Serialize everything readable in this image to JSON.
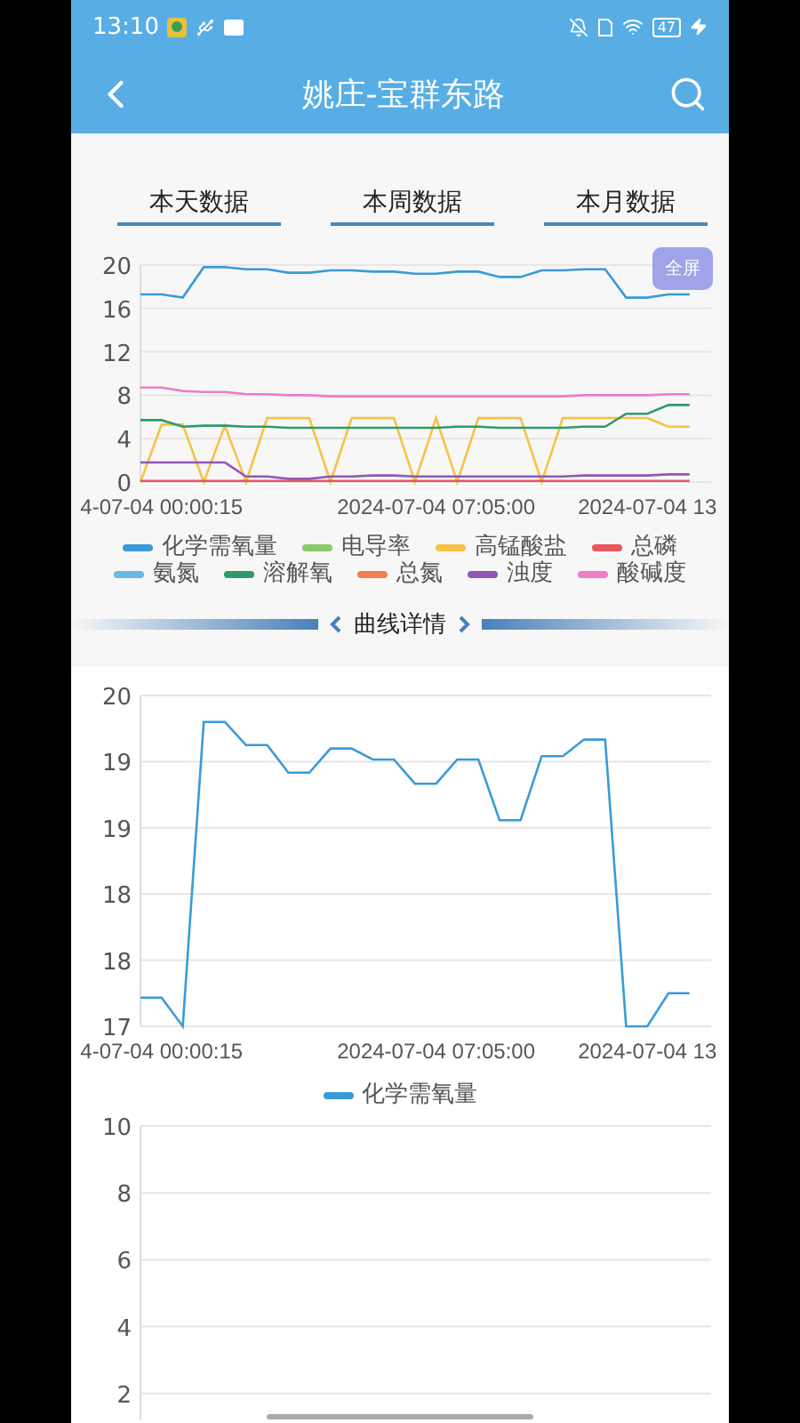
{
  "status_bar": {
    "time": "13:10",
    "battery": "47"
  },
  "header": {
    "title": "姚庄-宝群东路"
  },
  "tabs": [
    {
      "label": "本天数据"
    },
    {
      "label": "本周数据"
    },
    {
      "label": "本月数据"
    }
  ],
  "overview": {
    "fullscreen_button": "全屏",
    "chart_data": {
      "type": "line",
      "grid": true,
      "categories": [
        null,
        "4-07-04 00:00:15",
        null,
        null,
        null,
        null,
        null,
        null,
        null,
        null,
        null,
        null,
        null,
        null,
        "2024-07-04 07:05:00",
        null,
        null,
        null,
        null,
        null,
        null,
        null,
        null,
        null,
        "2024-07-04 13",
        null,
        null
      ],
      "ylim": [
        0,
        20
      ],
      "yticks": [
        0,
        4,
        8,
        12,
        16,
        20
      ],
      "series": [
        {
          "name": "化学需氧量",
          "color": "#3a9ad9",
          "values": [
            17.3,
            17.3,
            17.0,
            19.8,
            19.8,
            19.6,
            19.6,
            19.3,
            19.3,
            19.5,
            19.5,
            19.4,
            19.4,
            19.2,
            19.2,
            19.4,
            19.4,
            18.9,
            18.9,
            19.5,
            19.5,
            19.6,
            19.6,
            17.0,
            17.0,
            17.3,
            17.3
          ]
        },
        {
          "name": "电导率",
          "color": "#8bc96a",
          "values": [
            null,
            null,
            null,
            null,
            null,
            null,
            null,
            null,
            null,
            null,
            null,
            null,
            null,
            null,
            null,
            null,
            null,
            null,
            null,
            null,
            null,
            null,
            null,
            null,
            null,
            null,
            null
          ]
        },
        {
          "name": "高锰酸盐",
          "color": "#f7c244",
          "values": [
            0,
            5.3,
            5.3,
            0,
            5.2,
            0,
            5.9,
            5.9,
            5.9,
            0,
            5.9,
            5.9,
            5.9,
            0,
            5.9,
            0,
            5.9,
            5.9,
            5.9,
            0,
            5.9,
            5.9,
            5.9,
            5.9,
            5.9,
            5.1,
            5.1
          ]
        },
        {
          "name": "总磷",
          "color": "#e8565e",
          "values": [
            0.1,
            0.1,
            0.1,
            0.1,
            0.1,
            0.1,
            0.1,
            0.1,
            0.1,
            0.1,
            0.1,
            0.1,
            0.1,
            0.1,
            0.1,
            0.1,
            0.1,
            0.1,
            0.1,
            0.1,
            0.1,
            0.1,
            0.1,
            0.1,
            0.1,
            0.1,
            0.1
          ]
        },
        {
          "name": "氨氮",
          "color": "#6ab7e0",
          "values": [
            null,
            null,
            null,
            null,
            null,
            null,
            null,
            null,
            null,
            null,
            null,
            null,
            null,
            null,
            null,
            null,
            null,
            null,
            null,
            null,
            null,
            null,
            null,
            null,
            null,
            null,
            null
          ]
        },
        {
          "name": "溶解氧",
          "color": "#2e9a6a",
          "values": [
            5.7,
            5.7,
            5.1,
            5.2,
            5.2,
            5.1,
            5.1,
            5.0,
            5.0,
            5.0,
            5.0,
            5.0,
            5.0,
            5.0,
            5.0,
            5.1,
            5.1,
            5.0,
            5.0,
            5.0,
            5.0,
            5.1,
            5.1,
            6.3,
            6.3,
            7.1,
            7.1
          ]
        },
        {
          "name": "总氮",
          "color": "#f08050",
          "values": [
            null,
            null,
            null,
            null,
            null,
            null,
            null,
            null,
            null,
            null,
            null,
            null,
            null,
            null,
            null,
            null,
            null,
            null,
            null,
            null,
            null,
            null,
            null,
            null,
            null,
            null,
            null
          ]
        },
        {
          "name": "浊度",
          "color": "#9157b5",
          "values": [
            1.8,
            1.8,
            1.8,
            1.8,
            1.8,
            0.5,
            0.5,
            0.3,
            0.3,
            0.5,
            0.5,
            0.6,
            0.6,
            0.5,
            0.5,
            0.5,
            0.5,
            0.5,
            0.5,
            0.5,
            0.5,
            0.6,
            0.6,
            0.6,
            0.6,
            0.7,
            0.7
          ]
        },
        {
          "name": "酸碱度",
          "color": "#ec7ecb",
          "values": [
            8.7,
            8.7,
            8.4,
            8.3,
            8.3,
            8.1,
            8.1,
            8.0,
            8.0,
            7.9,
            7.9,
            7.9,
            7.9,
            7.9,
            7.9,
            7.9,
            7.9,
            7.9,
            7.9,
            7.9,
            7.9,
            8.0,
            8.0,
            8.0,
            8.0,
            8.1,
            8.1
          ]
        }
      ]
    }
  },
  "divider": {
    "label": "曲线详情"
  },
  "detail_charts": [
    {
      "chart_data": {
        "type": "line",
        "grid": true,
        "categories": [
          null,
          "4-07-04 00:00:15",
          null,
          null,
          null,
          null,
          null,
          null,
          null,
          null,
          null,
          null,
          null,
          null,
          "2024-07-04 07:05:00",
          null,
          null,
          null,
          null,
          null,
          null,
          null,
          null,
          null,
          "2024-07-04 13",
          null,
          null
        ],
        "ylim": [
          17,
          20
        ],
        "yticks": [
          {
            "value": 17,
            "label": "17"
          },
          {
            "value": 17.6,
            "label": "18"
          },
          {
            "value": 18.2,
            "label": "18"
          },
          {
            "value": 18.8,
            "label": "19"
          },
          {
            "value": 19.4,
            "label": "19"
          },
          {
            "value": 20,
            "label": "20"
          }
        ],
        "series": [
          {
            "name": "化学需氧量",
            "color": "#3a9ad9",
            "values": [
              17.26,
              17.26,
              17.0,
              19.76,
              19.76,
              19.55,
              19.55,
              19.3,
              19.3,
              19.52,
              19.52,
              19.42,
              19.42,
              19.2,
              19.2,
              19.42,
              19.42,
              18.87,
              18.87,
              19.45,
              19.45,
              19.6,
              19.6,
              17.0,
              17.0,
              17.3,
              17.3
            ]
          }
        ]
      }
    },
    {
      "chart_data": {
        "type": "line",
        "grid": true,
        "categories": [
          null,
          null,
          null,
          null,
          null,
          null,
          null,
          null,
          null,
          null,
          null,
          null,
          null,
          null,
          null,
          null,
          null,
          null,
          null,
          null,
          null,
          null,
          null,
          null,
          null,
          null,
          null
        ],
        "ylim": [
          0,
          10
        ],
        "yticks": [
          2,
          4,
          6,
          8,
          10
        ]
      }
    }
  ]
}
